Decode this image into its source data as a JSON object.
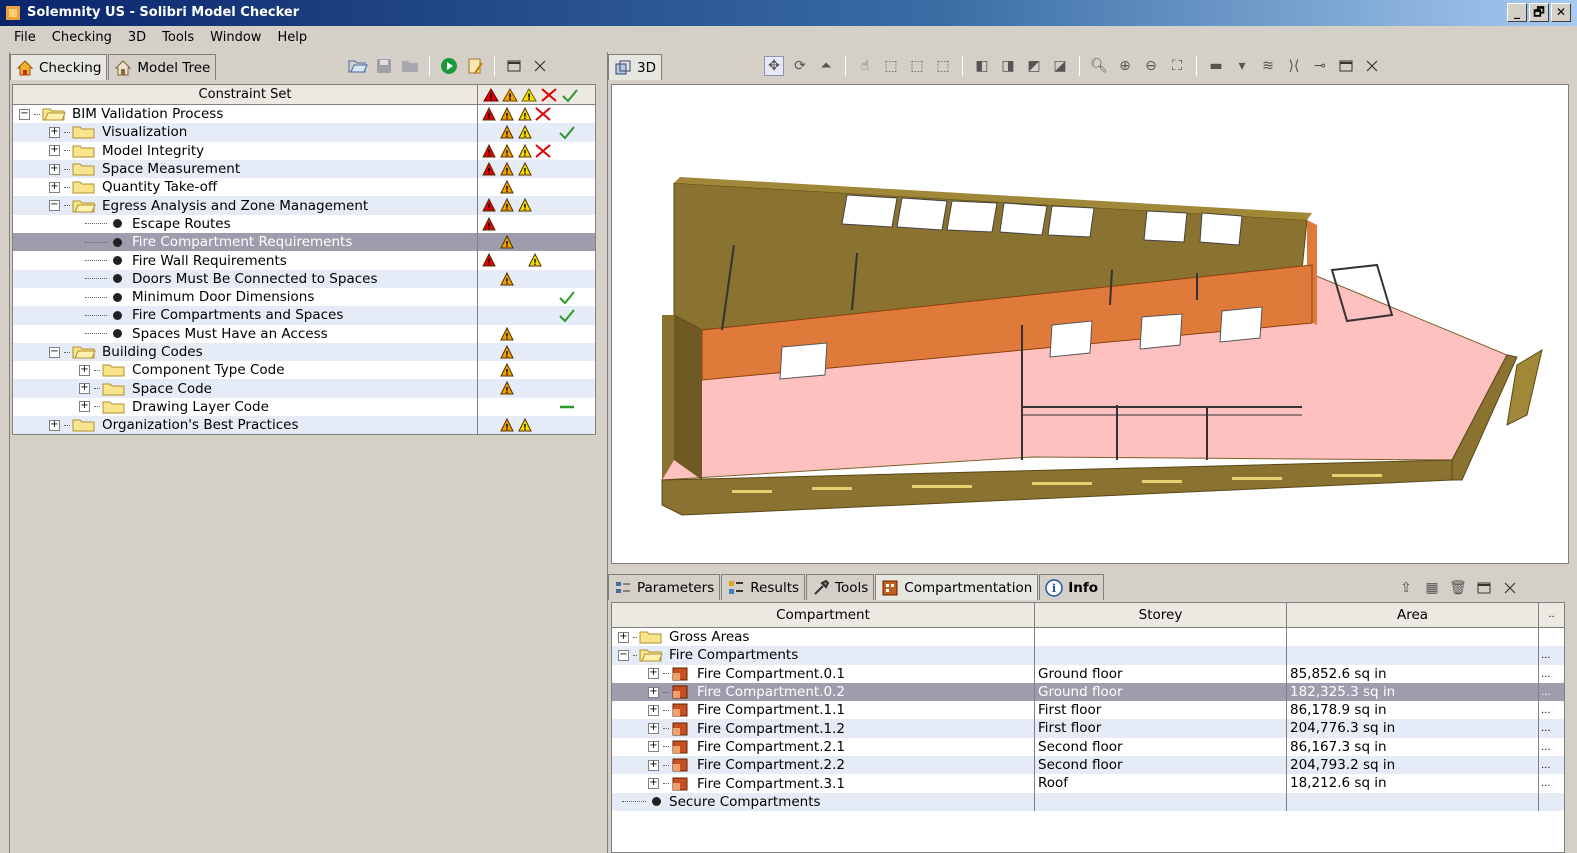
{
  "window": {
    "title": "Solemnity US - Solibri Model Checker",
    "btn_min": "_",
    "btn_max": "🗗",
    "btn_close": "✕"
  },
  "menu": [
    "File",
    "Checking",
    "3D",
    "Tools",
    "Window",
    "Help"
  ],
  "left_tabs": {
    "checking": "Checking",
    "model_tree": "Model Tree"
  },
  "tree": {
    "header": "Constraint Set",
    "rows": [
      {
        "label": "BIM Validation Process"
      },
      {
        "label": "Visualization"
      },
      {
        "label": "Model Integrity"
      },
      {
        "label": "Space Measurement"
      },
      {
        "label": "Quantity Take-off"
      },
      {
        "label": "Egress Analysis and Zone Management"
      },
      {
        "label": "Escape Routes"
      },
      {
        "label": "Fire Compartment Requirements"
      },
      {
        "label": "Fire Wall Requirements"
      },
      {
        "label": "Doors Must Be Connected to Spaces"
      },
      {
        "label": "Minimum Door Dimensions"
      },
      {
        "label": "Fire Compartments and Spaces"
      },
      {
        "label": "Spaces Must Have an Access"
      },
      {
        "label": "Building Codes"
      },
      {
        "label": "Component Type Code"
      },
      {
        "label": "Space Code"
      },
      {
        "label": "Drawing Layer Code"
      },
      {
        "label": "Organization's Best Practices"
      }
    ]
  },
  "view_tab": "3D",
  "bottom_tabs": {
    "parameters": "Parameters",
    "results": "Results",
    "tools": "Tools",
    "compartmentation": "Compartmentation",
    "info": "Info"
  },
  "grid": {
    "headers": {
      "compartment": "Compartment",
      "storey": "Storey",
      "area": "Area",
      "more": ".."
    },
    "rows": [
      {
        "name": "Gross Areas",
        "storey": "",
        "area": ""
      },
      {
        "name": "Fire Compartments",
        "storey": "",
        "area": "",
        "more": "..."
      },
      {
        "name": "Fire Compartment.0.1",
        "storey": "Ground floor",
        "area": "85,852.6 sq in",
        "more": "..."
      },
      {
        "name": "Fire Compartment.0.2",
        "storey": "Ground floor",
        "area": "182,325.3 sq in",
        "more": "..."
      },
      {
        "name": "Fire Compartment.1.1",
        "storey": "First floor",
        "area": "86,178.9 sq in",
        "more": "..."
      },
      {
        "name": "Fire Compartment.1.2",
        "storey": "First floor",
        "area": "204,776.3 sq in",
        "more": "..."
      },
      {
        "name": "Fire Compartment.2.1",
        "storey": "Second floor",
        "area": "86,167.3 sq in",
        "more": "..."
      },
      {
        "name": "Fire Compartment.2.2",
        "storey": "Second floor",
        "area": "204,793.2 sq in",
        "more": "..."
      },
      {
        "name": "Fire Compartment.3.1",
        "storey": "Roof",
        "area": "18,212.6 sq in",
        "more": "..."
      },
      {
        "name": "Secure Compartments",
        "storey": "",
        "area": ""
      }
    ]
  },
  "colors": {
    "critical": "#e00000",
    "moderate": "#f0a000",
    "low": "#f5dc00",
    "reject": "#e00000",
    "accept": "#2a9a2a",
    "selection": "#9d9dad",
    "wall": "#8a7230",
    "wall_orange": "#e07a3a",
    "floor": "#ffc0c0"
  }
}
